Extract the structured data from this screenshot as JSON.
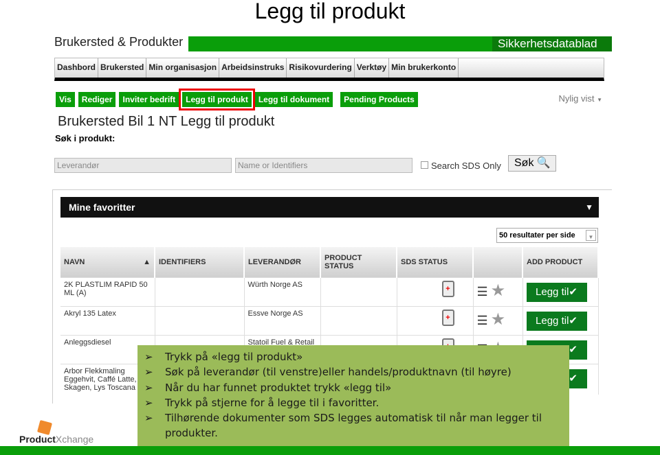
{
  "slide_title": "Legg til produkt",
  "header": {
    "brand": "Brukersted & Produkter",
    "sds_link": "Sikkerhetsdatablad"
  },
  "nav": [
    "Dashbord",
    "Brukersted",
    "Min organisasjon",
    "Arbeidsinstruks",
    "Risikovurdering",
    "Verktøy",
    "Min brukerkonto"
  ],
  "actions": [
    "Vis",
    "Rediger",
    "Inviter bedrift",
    "Legg til produkt",
    "Legg til dokument",
    "Pending Products"
  ],
  "recent": "Nylig vist",
  "page_title": "Brukersted Bil 1 NT Legg til produkt",
  "search": {
    "label": "Søk i produkt:",
    "supplier_placeholder": "Leverandør",
    "name_placeholder": "Name or Identifiers",
    "sds_only": "Search SDS Only",
    "button": "Søk"
  },
  "favorites": {
    "title": "Mine favoritter",
    "per_page": "50 resultater per side"
  },
  "table": {
    "headers": [
      "NAVN",
      "IDENTIFIERS",
      "LEVERANDØR",
      "PRODUCT STATUS",
      "SDS STATUS",
      "",
      "ADD PRODUCT"
    ],
    "rows": [
      {
        "name": "2K PLASTLIM RAPID 50 ML (A)",
        "supplier": "Würth Norge AS",
        "add": "Legg til✔"
      },
      {
        "name": "Akryl 135 Latex",
        "supplier": "Essve Norge AS",
        "add": "Legg til✔"
      },
      {
        "name": "Anleggsdiesel",
        "supplier": "Statoil Fuel & Retail",
        "add": "Legg til✔"
      },
      {
        "name": "Arbor Flekkmaling Eggehvit, Caffé Latte, Skagen, Lys Toscana",
        "supplier": "",
        "add": "Legg til✔"
      }
    ]
  },
  "instructions": [
    "Trykk på «legg til produkt»",
    "Søk på leverandør (til venstre)eller handels/produktnavn (til høyre)",
    "Når du har funnet produktet trykk «legg til»",
    "Trykk på stjerne for å legge til i favoritter.",
    "Tilhørende dokumenter som SDS legges automatisk til når man legger til produkter."
  ],
  "logo": "ProductXchange",
  "colors": {
    "green": "#0a9e0a",
    "dark_green": "#0b7a1e",
    "overlay": "#9bbb59",
    "highlight": "#ee0000",
    "logo_orange": "#f08a2c"
  }
}
